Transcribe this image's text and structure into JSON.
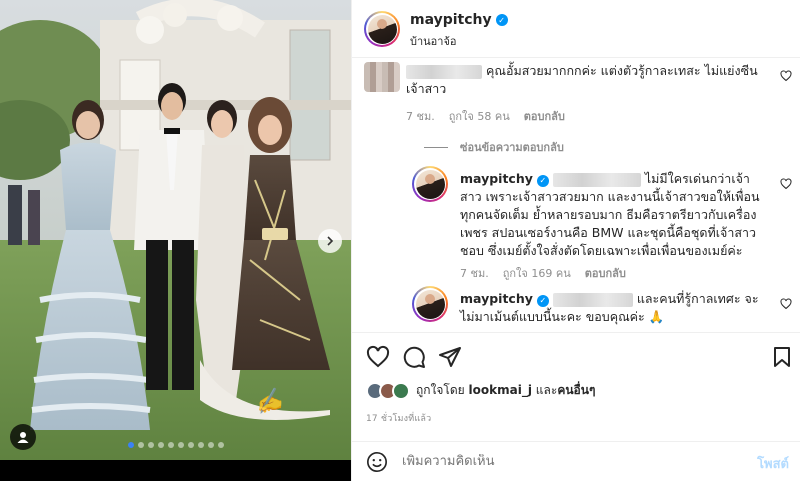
{
  "header": {
    "username": "maypitchy",
    "location": "บ้านอาจ้อ"
  },
  "comments": {
    "first": {
      "text": "คุณอั้มสวยมากกกค่ะ แต่งตัวรู้กาละเทสะ ไม่แย่งซีนเจ้าสาว",
      "time": "7 ชม.",
      "likes": "ถูกใจ 58 คน",
      "reply_label": "ตอบกลับ"
    },
    "hide_replies": "ซ่อนข้อความตอบกลับ",
    "replies": [
      {
        "username": "maypitchy",
        "text": "ไม่มีใครเด่นกว่าเจ้าสาว เพราะเจ้าสาวสวยมาก และงานนี้เจ้าสาวขอให้เพื่อนทุกคนจัดเต็ม ย้ำหลายรอบมาก ธีมคือราตรียาวกับเครื่องเพชร สปอนเซอร์งานคือ BMW และชุดนี้คือชุดที่เจ้าสาวชอบ ซึ่งเมย์ตั้งใจสั่งตัดโดยเฉพาะเพื่อเพื่อนของเมย์ค่ะ",
        "time": "7 ชม.",
        "likes": "ถูกใจ 169 คน",
        "reply_label": "ตอบกลับ"
      },
      {
        "username": "maypitchy",
        "text": "และคนที่รู้กาลเทศะ จะไม่มาเม้นต์แบบนี้นะคะ ขอบคุณค่ะ 🙏"
      }
    ]
  },
  "likes_line": {
    "prefix": "ถูกใจโดย",
    "user": "lookmai_j",
    "joiner": "และ",
    "others": "คนอื่นๆ"
  },
  "time_ago": "17 ชั่วโมงที่แล้ว",
  "add_comment": {
    "placeholder": "เพิ่มความคิดเห็น",
    "post_label": "โพสต์"
  },
  "carousel": {
    "slide_count": 10,
    "active_index": 0
  },
  "colors": {
    "accent": "#0095f6",
    "post_disabled": "#b3dbff",
    "active_dot": "#3b82f6"
  }
}
